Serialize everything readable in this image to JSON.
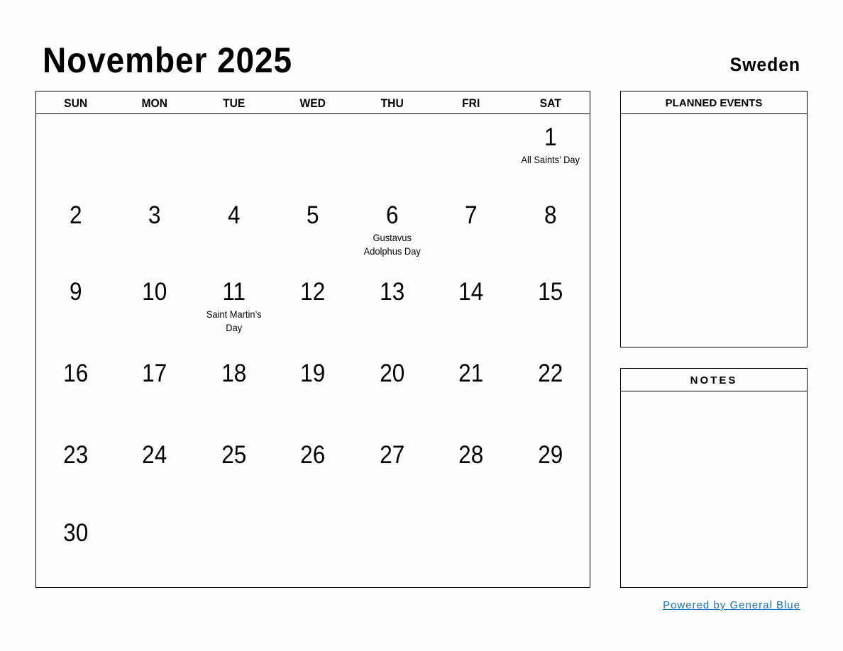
{
  "header": {
    "title": "November 2025",
    "country": "Sweden"
  },
  "weekdays": [
    "SUN",
    "MON",
    "TUE",
    "WED",
    "THU",
    "FRI",
    "SAT"
  ],
  "weeks": [
    [
      {
        "d": ""
      },
      {
        "d": ""
      },
      {
        "d": ""
      },
      {
        "d": ""
      },
      {
        "d": ""
      },
      {
        "d": ""
      },
      {
        "d": "1",
        "h": "All Saints’ Day"
      }
    ],
    [
      {
        "d": "2"
      },
      {
        "d": "3"
      },
      {
        "d": "4"
      },
      {
        "d": "5"
      },
      {
        "d": "6",
        "h": "Gustavus Adolphus Day"
      },
      {
        "d": "7"
      },
      {
        "d": "8"
      }
    ],
    [
      {
        "d": "9"
      },
      {
        "d": "10"
      },
      {
        "d": "11",
        "h": "Saint Martin’s Day"
      },
      {
        "d": "12"
      },
      {
        "d": "13"
      },
      {
        "d": "14"
      },
      {
        "d": "15"
      }
    ],
    [
      {
        "d": "16"
      },
      {
        "d": "17"
      },
      {
        "d": "18"
      },
      {
        "d": "19"
      },
      {
        "d": "20"
      },
      {
        "d": "21"
      },
      {
        "d": "22"
      }
    ],
    [
      {
        "d": "23"
      },
      {
        "d": "24"
      },
      {
        "d": "25"
      },
      {
        "d": "26"
      },
      {
        "d": "27"
      },
      {
        "d": "28"
      },
      {
        "d": "29"
      }
    ],
    [
      {
        "d": "30"
      },
      {
        "d": ""
      },
      {
        "d": ""
      },
      {
        "d": ""
      },
      {
        "d": ""
      },
      {
        "d": ""
      },
      {
        "d": ""
      }
    ]
  ],
  "panels": {
    "planned_events": "PLANNED EVENTS",
    "notes": "NOTES"
  },
  "footer": {
    "powered_by": "Powered by General Blue",
    "link_color": "#1a6fc4"
  }
}
